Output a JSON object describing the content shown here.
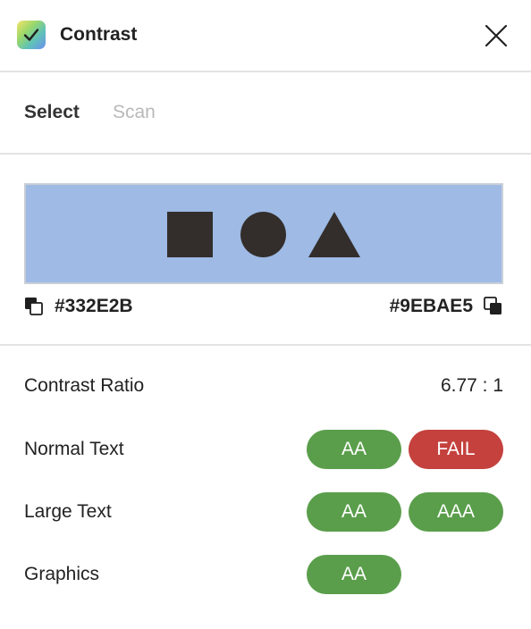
{
  "app": {
    "title": "Contrast",
    "icon": "check-icon",
    "close_icon": "close-icon"
  },
  "tabs": [
    {
      "label": "Select",
      "active": true
    },
    {
      "label": "Scan",
      "active": false
    }
  ],
  "preview": {
    "foreground": "#332E2B",
    "background": "#9EBAE5",
    "shapes": [
      "square",
      "circle",
      "triangle"
    ]
  },
  "colors": {
    "foreground_label": "#332E2B",
    "background_label": "#9EBAE5",
    "foreground_icon": "swap-foreground-icon",
    "background_icon": "swap-background-icon"
  },
  "results": {
    "contrast_label": "Contrast Ratio",
    "contrast_value": "6.77 : 1",
    "rows": [
      {
        "label": "Normal Text",
        "badges": [
          {
            "text": "AA",
            "status": "pass"
          },
          {
            "text": "FAIL",
            "status": "fail"
          }
        ]
      },
      {
        "label": "Large Text",
        "badges": [
          {
            "text": "AA",
            "status": "pass"
          },
          {
            "text": "AAA",
            "status": "pass"
          }
        ]
      },
      {
        "label": "Graphics",
        "badges": [
          {
            "text": "AA",
            "status": "pass"
          }
        ]
      }
    ]
  },
  "status_colors": {
    "pass": "#5A9E4B",
    "fail": "#C4413D"
  }
}
